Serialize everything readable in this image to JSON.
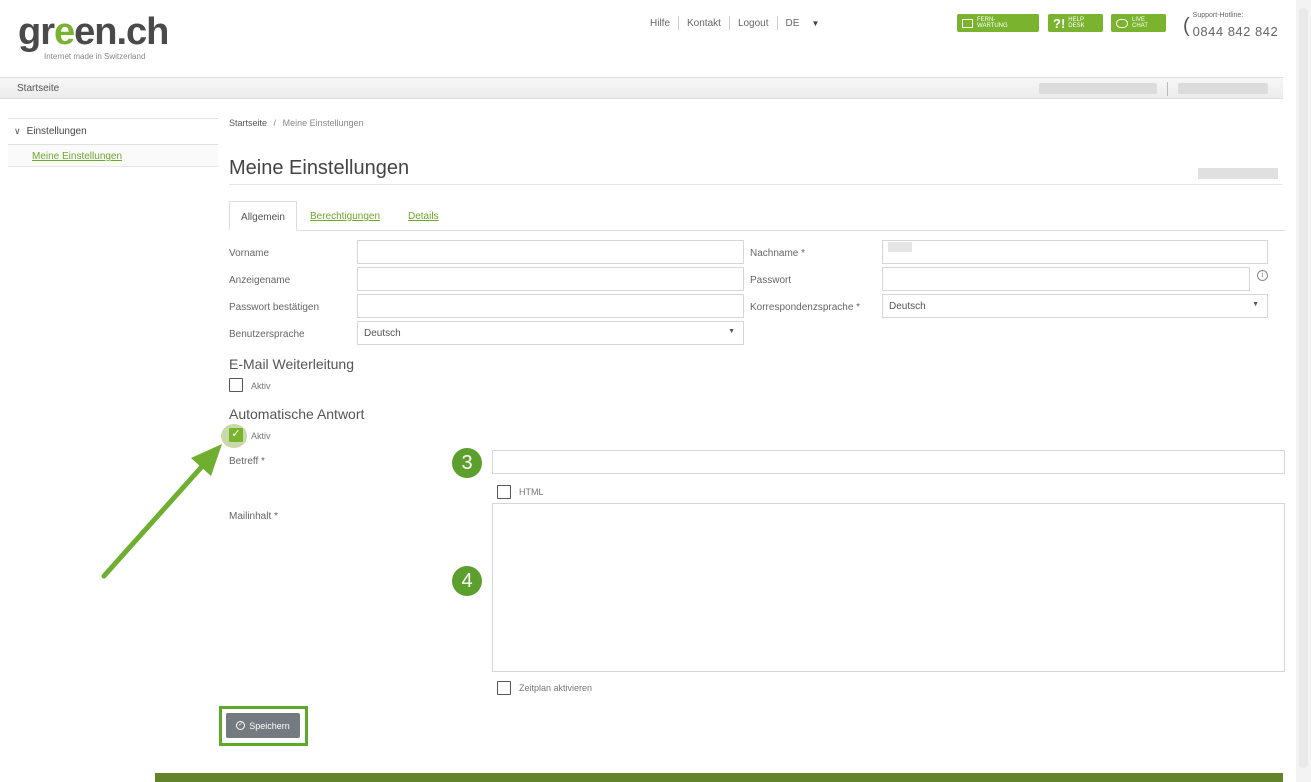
{
  "header": {
    "logo_main_pre": "gr",
    "logo_main_e": "e",
    "logo_main_post": "en.ch",
    "logo_sub": "Internet made in Switzerland",
    "nav": [
      "Hilfe",
      "Kontakt",
      "Logout",
      "DE"
    ],
    "buttons": [
      {
        "line1": "FERN-",
        "line2": "WARTUNG"
      },
      {
        "big": "?!",
        "line1": "HELP",
        "line2": "DESK"
      },
      {
        "line1": "LIVE",
        "line2": "CHAT"
      }
    ],
    "hotline_label": "Support-Hotline:",
    "hotline_number": "0844 842 842",
    "accent_color": "#7ab32e"
  },
  "mainbar": {
    "home": "Startseite"
  },
  "sidebar": {
    "section": "Einstellungen",
    "items": [
      "Meine Einstellungen"
    ]
  },
  "breadcrumb": {
    "home": "Startseite",
    "sep": "/",
    "current": "Meine Einstellungen"
  },
  "page": {
    "title": "Meine Einstellungen"
  },
  "tabs": [
    "Allgemein",
    "Berechtigungen",
    "Details"
  ],
  "form": {
    "vorname": {
      "label": "Vorname",
      "value": ""
    },
    "anzeigename": {
      "label": "Anzeigename",
      "value": ""
    },
    "passwort_bestaetigen": {
      "label": "Passwort bestätigen",
      "value": ""
    },
    "benutzersprache": {
      "label": "Benutzersprache",
      "value": "Deutsch"
    },
    "nachname": {
      "label": "Nachname *",
      "value": ""
    },
    "passwort": {
      "label": "Passwort",
      "value": ""
    },
    "korrespondenzsprache": {
      "label": "Korrespondenzsprache *",
      "value": "Deutsch"
    }
  },
  "weiterleitung": {
    "title": "E-Mail Weiterleitung",
    "aktiv_label": "Aktiv",
    "aktiv_checked": false
  },
  "autoreply": {
    "title": "Automatische Antwort",
    "aktiv_label": "Aktiv",
    "aktiv_checked": true,
    "betreff_label": "Betreff *",
    "betreff_value": "",
    "html_label": "HTML",
    "mailinhalt_label": "Mailinhalt *",
    "zeitplan_label": "Zeitplan aktivieren"
  },
  "badges": [
    "3",
    "4"
  ],
  "save_label": "Speichern",
  "icons": {
    "chevron": "chevron-down-icon",
    "caret": "caret-down-icon",
    "info": "info-icon",
    "check": "check-icon",
    "phone": "phone-icon",
    "save": "check-circle-icon"
  }
}
